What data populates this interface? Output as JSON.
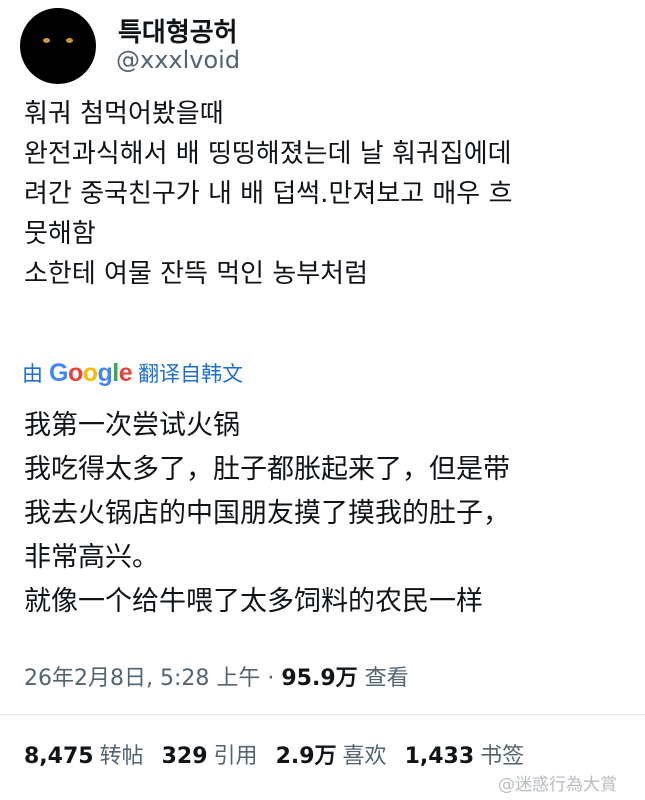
{
  "author": {
    "display_name": "특대형공허",
    "handle": "@xxxlvoid"
  },
  "tweet": {
    "original_lines": [
      "훠궈 첨먹어봤을때",
      "완전과식해서 배 띵띵해졌는데 날 훠궈집에데",
      "려간 중국친구가 내 배 덥썩.만져보고 매우 흐",
      "뭇해함",
      "소한테 여물 잔뜩 먹인 농부처럼"
    ],
    "translated_by": {
      "prefix": "由",
      "provider": "Google",
      "suffix": "翻译自韩文"
    },
    "translated_lines": [
      "我第一次尝试火锅",
      "我吃得太多了，肚子都胀起来了，但是带",
      "我去火锅店的中国朋友摸了摸我的肚子，",
      "非常高兴。",
      "就像一个给牛喂了太多饲料的农民一样"
    ]
  },
  "meta": {
    "timestamp": "26年2月8日, 5:28 上午",
    "separator": "·",
    "views_count": "95.9万",
    "views_label": "查看"
  },
  "stats": {
    "retweets_count": "8,475",
    "retweets_label": "转帖",
    "quotes_count": "329",
    "quotes_label": "引用",
    "likes_count": "2.9万",
    "likes_label": "喜欢",
    "bookmarks_count": "1,433",
    "bookmarks_label": "书签"
  },
  "watermark": "@迷惑行為大賞"
}
